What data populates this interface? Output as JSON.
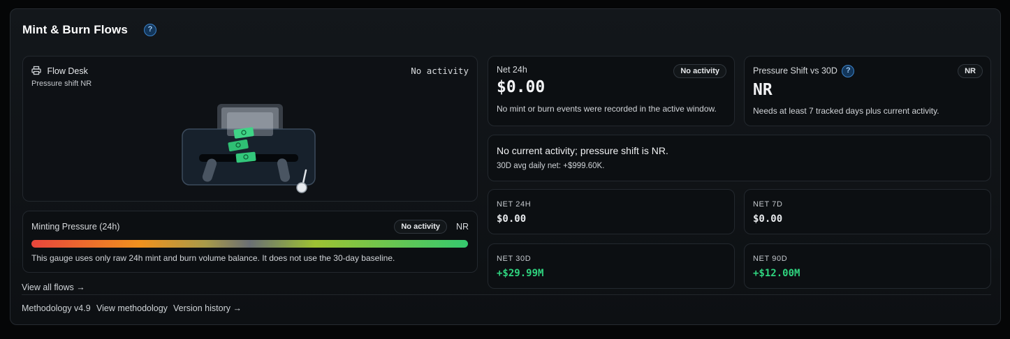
{
  "panel": {
    "title": "Mint & Burn Flows",
    "help_glyph": "?"
  },
  "flow_desk": {
    "title": "Flow Desk",
    "icon": "printer-icon",
    "subtitle": "Pressure shift NR",
    "status": "No activity"
  },
  "minting_pressure": {
    "title": "Minting Pressure (24h)",
    "badge": "No activity",
    "value": "NR",
    "gauge_colors": [
      "#e8453c",
      "#f0921e",
      "#a89a4a",
      "#6a6f74",
      "#9ec233",
      "#35c96e"
    ],
    "description": "This gauge uses only raw 24h mint and burn volume balance. It does not use the 30-day baseline."
  },
  "links": {
    "view_all_flows": "View all flows →",
    "methodology_version": "Methodology v4.9",
    "view_methodology": "View methodology",
    "version_history": "Version history →"
  },
  "net_24h_card": {
    "label": "Net 24h",
    "badge": "No activity",
    "value": "$0.00",
    "description": "No mint or burn events were recorded in the active window."
  },
  "pressure_shift_card": {
    "label": "Pressure Shift vs 30D",
    "help_glyph": "?",
    "badge": "NR",
    "value": "NR",
    "description": "Needs at least 7 tracked days plus current activity."
  },
  "activity_summary": {
    "headline": "No current activity; pressure shift is NR.",
    "detail": "30D avg daily net: +$999.60K."
  },
  "stats": [
    {
      "label": "NET 24H",
      "value": "$0.00"
    },
    {
      "label": "NET 7D",
      "value": "$0.00"
    },
    {
      "label": "NET 30D",
      "value": "+$29.99M"
    },
    {
      "label": "NET 90D",
      "value": "+$12.00M"
    }
  ],
  "colors": {
    "positive": "#2fd47f",
    "accent_help": "#3b82c9",
    "background": "#0c0f12"
  }
}
